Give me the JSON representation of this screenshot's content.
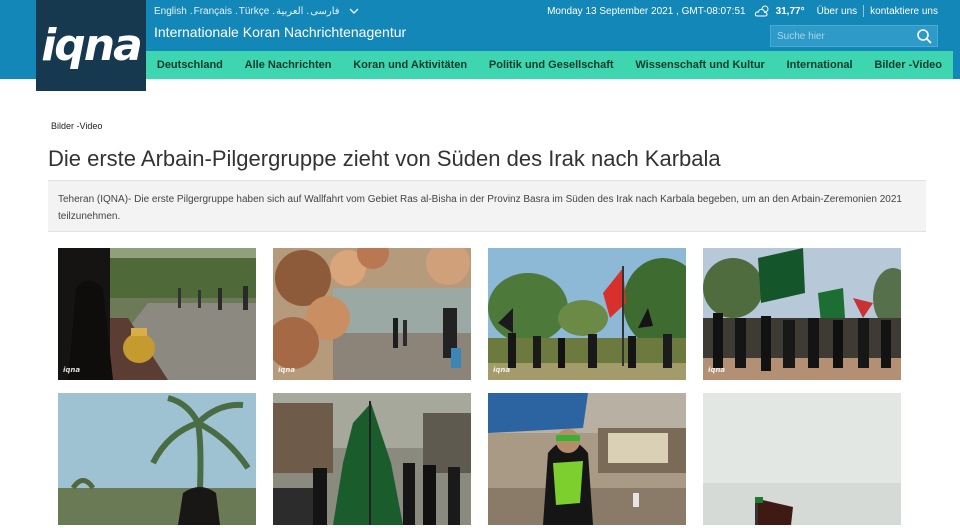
{
  "header": {
    "languages": [
      "English",
      "Français",
      "Türkçe",
      "العربية",
      "فارسی"
    ],
    "site_title": "Internationale Koran Nachrichtenagentur",
    "logo_text": "iqna",
    "date": "Monday 13 September 2021",
    "time": "GMT-08:07:51",
    "temperature": "31,77°",
    "about_link": "Über uns",
    "contact_link": "kontaktiere uns",
    "search_placeholder": "Suche hier",
    "accent_color": "#1387b8",
    "nav_color": "#3ed6b0",
    "logo_bg_color": "#16394f"
  },
  "nav": {
    "items": [
      "Deutschland",
      "Alle Nachrichten",
      "Koran und Aktivitäten",
      "Politik und Gesellschaft",
      "Wissenschaft und Kultur",
      "International",
      "Bilder -Video"
    ]
  },
  "article": {
    "breadcrumb": "Bilder -Video",
    "title": "Die erste Arbain-Pilgergruppe zieht von Süden des Irak nach Karbala",
    "lead": "Teheran (IQNA)- Die erste Pilgergruppe haben sich auf Wallfahrt vom Gebiet Ras al-Bisha in der Provinz Basra im Süden des Irak nach Karbala begeben, um an den Arbain-Zeremonien 2021 teilzunehmen."
  },
  "gallery": {
    "watermark": "iqna",
    "photos": [
      "photo-1",
      "photo-2",
      "photo-3",
      "photo-4",
      "photo-5",
      "photo-6",
      "photo-7",
      "photo-8"
    ]
  }
}
